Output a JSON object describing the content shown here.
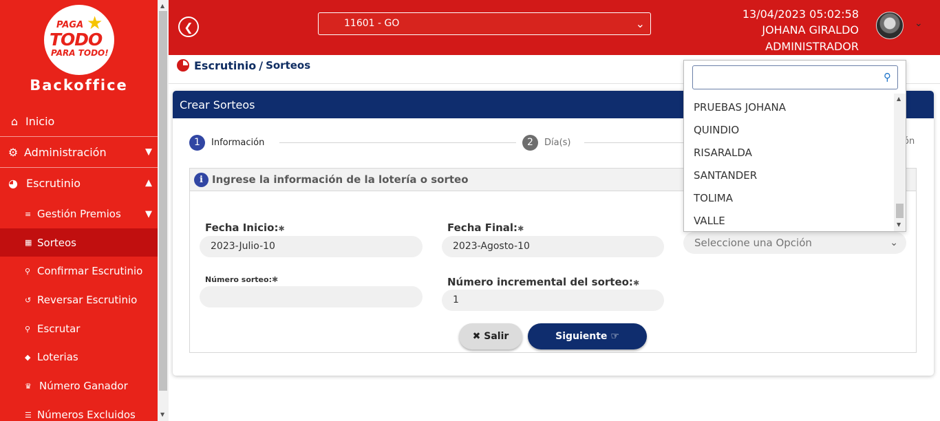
{
  "sidebar": {
    "logo": {
      "line1": "PAGA",
      "line2": "TODO",
      "line3": "PARA TODO!",
      "star": "$"
    },
    "brand": "Backoffice",
    "items": [
      {
        "label": "Inicio",
        "icon": "home-icon"
      },
      {
        "label": "Administración",
        "icon": "gear-icon"
      },
      {
        "label": "Escrutinio",
        "icon": "pie-chart-icon"
      }
    ],
    "subitems": [
      {
        "label": "Gestión Premios"
      },
      {
        "label": "Sorteos"
      },
      {
        "label": "Confirmar Escrutinio"
      },
      {
        "label": "Reversar Escrutinio"
      },
      {
        "label": "Escrutar"
      },
      {
        "label": "Loterias"
      },
      {
        "label": "Número Ganador"
      },
      {
        "label": "Números Excluidos"
      }
    ]
  },
  "header": {
    "office_select": "11601 - GO",
    "datetime": "13/04/2023 05:02:58",
    "user_name": "JOHANA GIRALDO",
    "role": "ADMINISTRADOR"
  },
  "breadcrumb": {
    "section": "Escrutinio",
    "separator": "/",
    "page": "Sorteos"
  },
  "card": {
    "title": "Crear Sorteos",
    "steps": [
      {
        "num": "1",
        "label": "Información"
      },
      {
        "num": "2",
        "label": "Día(s)"
      },
      {
        "label": "ón"
      }
    ],
    "info_text": "Ingrese la información de la lotería o sorteo",
    "fields": {
      "fecha_inicio_label": "Fecha Inicio:",
      "fecha_inicio_value": "2023-Julio-10",
      "fecha_final_label": "Fecha Final:",
      "fecha_final_value": "2023-Agosto-10",
      "numero_sorteo_label": "Número sorteo:",
      "numero_sorteo_value": "",
      "numero_incremental_label": "Número incremental del sorteo:",
      "numero_incremental_value": "1",
      "select_placeholder": "Seleccione una Opción",
      "required_mark": "✱"
    },
    "buttons": {
      "salir": "Salir",
      "siguiente": "Siguiente"
    }
  },
  "dropdown": {
    "search_value": "",
    "options": [
      "PRUEBAS JOHANA",
      "QUINDIO",
      "RISARALDA",
      "SANTANDER",
      "TOLIMA",
      "VALLE"
    ]
  },
  "colors": {
    "brand_red": "#e8231a",
    "header_red": "#d21918",
    "navy": "#0f2d6e",
    "step_active": "#3146a3"
  }
}
